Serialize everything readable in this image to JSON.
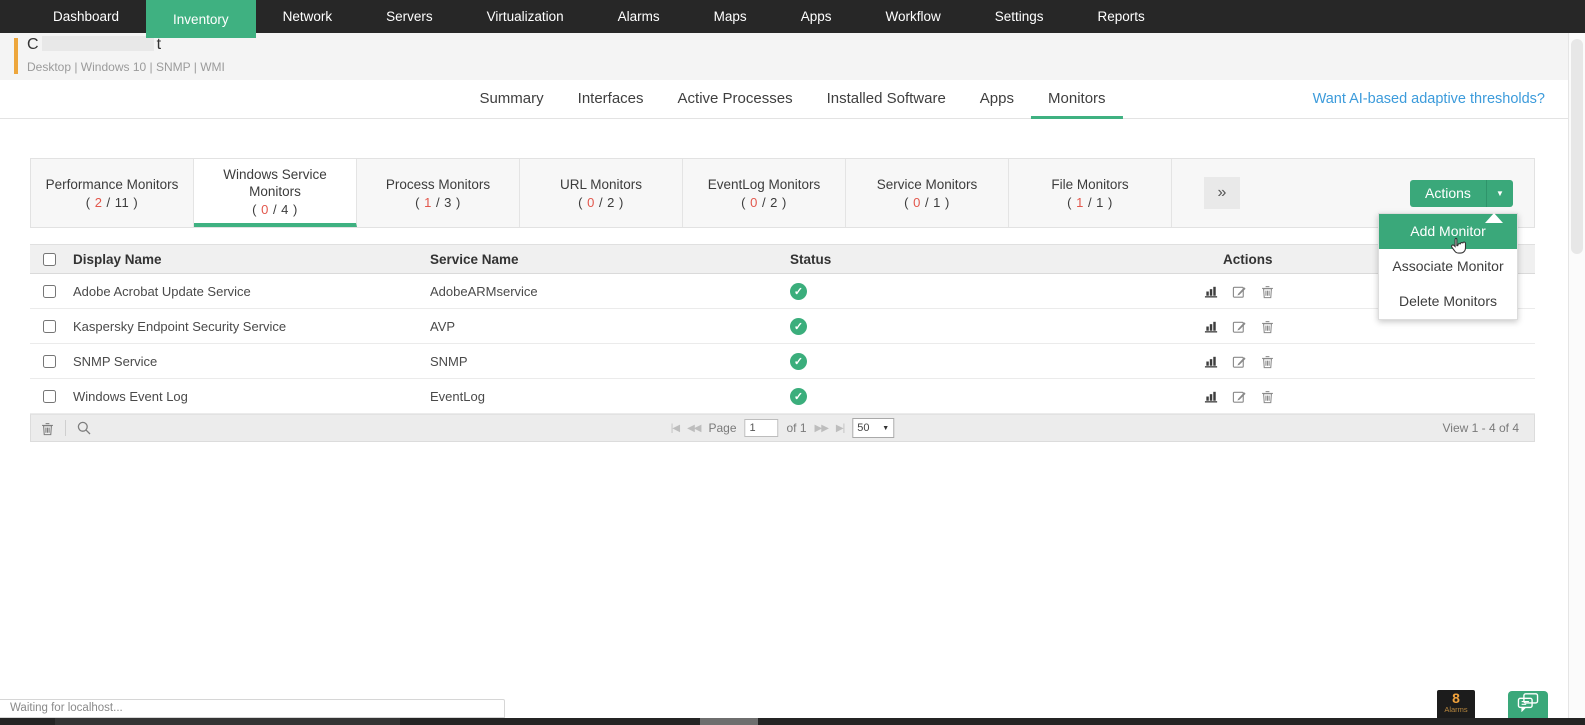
{
  "colors": {
    "accent_green": "#3fb181",
    "nav_dark": "#272727",
    "alert_red": "#e2574c",
    "link_blue": "#3c9bdb",
    "orange": "#eda63c"
  },
  "nav": {
    "items": [
      "Dashboard",
      "Inventory",
      "Network",
      "Servers",
      "Virtualization",
      "Alarms",
      "Maps",
      "Apps",
      "Workflow",
      "Settings",
      "Reports"
    ],
    "active": "Inventory"
  },
  "icons": {
    "kebab": "⋮",
    "caret_down": "▼",
    "double_chevron": "»",
    "check": "✓",
    "pager_first": "|◀",
    "pager_prev": "◀◀",
    "pager_next": "▶▶",
    "pager_last": "▶|",
    "select_caret": "▼"
  },
  "device": {
    "name_start": "C",
    "name_end": "t",
    "meta": "Desktop | Windows 10  | SNMP  | WMI"
  },
  "page_tabs": {
    "items": [
      "Summary",
      "Interfaces",
      "Active Processes",
      "Installed Software",
      "Apps",
      "Monitors"
    ],
    "active": "Monitors",
    "ai_link": "Want AI-based adaptive thresholds?"
  },
  "monitor_tabs": {
    "fmt": {
      "open": "( ",
      "sep": " / ",
      "close": " )"
    },
    "active": "Windows Service Monitors",
    "items": [
      {
        "label": "Performance Monitors",
        "down": "2",
        "total": "11"
      },
      {
        "label": "Windows Service Monitors",
        "down": "0",
        "total": "4"
      },
      {
        "label": "Process Monitors",
        "down": "1",
        "total": "3"
      },
      {
        "label": "URL Monitors",
        "down": "0",
        "total": "2"
      },
      {
        "label": "EventLog Monitors",
        "down": "0",
        "total": "2"
      },
      {
        "label": "Service Monitors",
        "down": "0",
        "total": "1"
      },
      {
        "label": "File Monitors",
        "down": "1",
        "total": "1"
      }
    ]
  },
  "actions": {
    "label": "Actions",
    "highlighted": "Add Monitor",
    "menu": [
      "Add Monitor",
      "Associate Monitor",
      "Delete Monitors"
    ]
  },
  "table": {
    "headers": {
      "display_name": "Display Name",
      "service_name": "Service Name",
      "status": "Status",
      "actions": "Actions"
    },
    "rows": [
      {
        "display_name": "Adobe Acrobat Update Service",
        "service_name": "AdobeARMservice",
        "status": "up"
      },
      {
        "display_name": "Kaspersky Endpoint Security Service",
        "service_name": "AVP",
        "status": "up"
      },
      {
        "display_name": "SNMP Service",
        "service_name": "SNMP",
        "status": "up"
      },
      {
        "display_name": "Windows Event Log",
        "service_name": "EventLog",
        "status": "up"
      }
    ]
  },
  "pagination": {
    "page_label": "Page",
    "page_value": "1",
    "of_label": "of 1",
    "page_size": "50",
    "view_label": "View 1 - 4 of 4"
  },
  "status_bar": {
    "message": "Waiting for localhost..."
  },
  "alarms": {
    "count": "8",
    "label": "Alarms"
  }
}
